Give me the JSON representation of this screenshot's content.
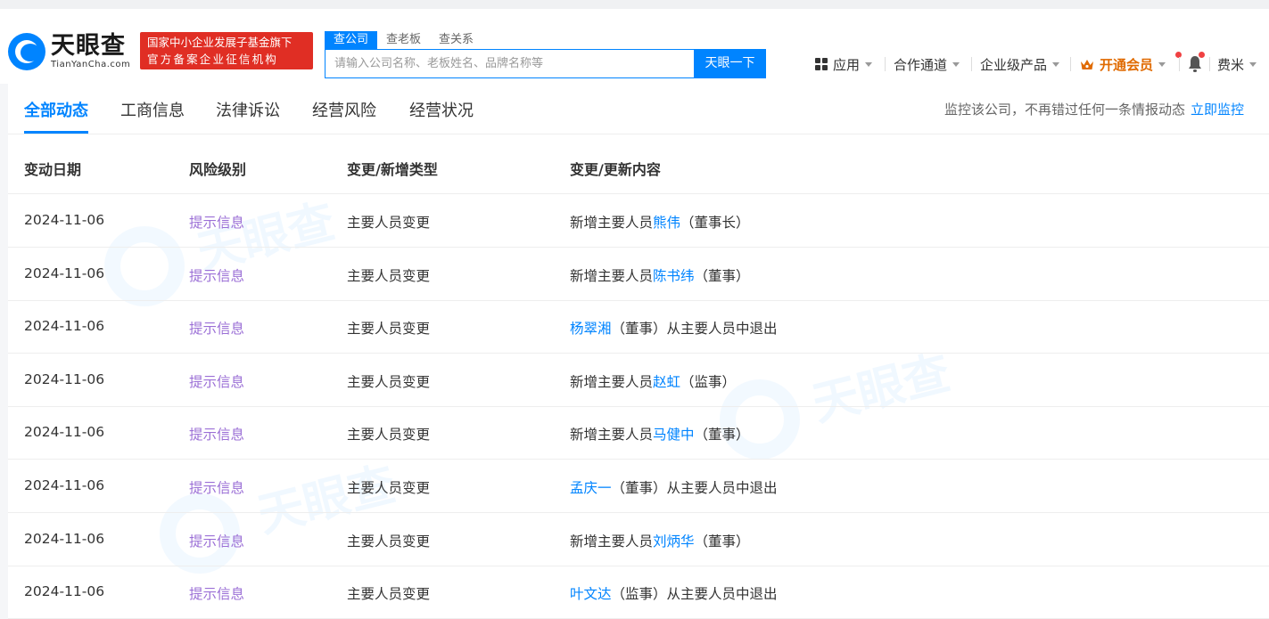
{
  "header": {
    "logo_cn": "天眼查",
    "logo_en": "TianYanCha.com",
    "badge_line1": "国家中小企业发展子基金旗下",
    "badge_line2": "官方备案企业征信机构",
    "search_tabs": [
      "查公司",
      "查老板",
      "查关系"
    ],
    "search_placeholder": "请输入公司名称、老板姓名、品牌名称等",
    "search_button": "天眼一下",
    "nav": {
      "apps": "应用",
      "cooperation": "合作通道",
      "enterprise": "企业级产品",
      "vip": "开通会员",
      "user": "费米"
    }
  },
  "tabs": [
    "全部动态",
    "工商信息",
    "法律诉讼",
    "经营风险",
    "经营状况"
  ],
  "monitor": {
    "text": "监控该公司，不再错过任何一条情报动态",
    "link": "立即监控"
  },
  "table": {
    "headers": [
      "变动日期",
      "风险级别",
      "变更/新增类型",
      "变更/更新内容"
    ],
    "rows": [
      {
        "date": "2024-11-06",
        "risk": "提示信息",
        "type": "主要人员变更",
        "prefix": "新增主要人员",
        "name": "熊伟",
        "suffix": "（董事长）"
      },
      {
        "date": "2024-11-06",
        "risk": "提示信息",
        "type": "主要人员变更",
        "prefix": "新增主要人员",
        "name": "陈书纬",
        "suffix": "（董事）"
      },
      {
        "date": "2024-11-06",
        "risk": "提示信息",
        "type": "主要人员变更",
        "prefix": "",
        "name": "杨翠湘",
        "suffix": "（董事）从主要人员中退出"
      },
      {
        "date": "2024-11-06",
        "risk": "提示信息",
        "type": "主要人员变更",
        "prefix": "新增主要人员",
        "name": "赵虹",
        "suffix": "（监事）"
      },
      {
        "date": "2024-11-06",
        "risk": "提示信息",
        "type": "主要人员变更",
        "prefix": "新增主要人员",
        "name": "马健中",
        "suffix": "（董事）"
      },
      {
        "date": "2024-11-06",
        "risk": "提示信息",
        "type": "主要人员变更",
        "prefix": "",
        "name": "孟庆一",
        "suffix": "（董事）从主要人员中退出"
      },
      {
        "date": "2024-11-06",
        "risk": "提示信息",
        "type": "主要人员变更",
        "prefix": "新增主要人员",
        "name": "刘炳华",
        "suffix": "（董事）"
      },
      {
        "date": "2024-11-06",
        "risk": "提示信息",
        "type": "主要人员变更",
        "prefix": "",
        "name": "叶文达",
        "suffix": "（监事）从主要人员中退出"
      }
    ]
  },
  "colors": {
    "accent": "#0084ff",
    "badge": "#e02e24",
    "risk": "#9b6fd6",
    "vip": "#e06a00"
  }
}
